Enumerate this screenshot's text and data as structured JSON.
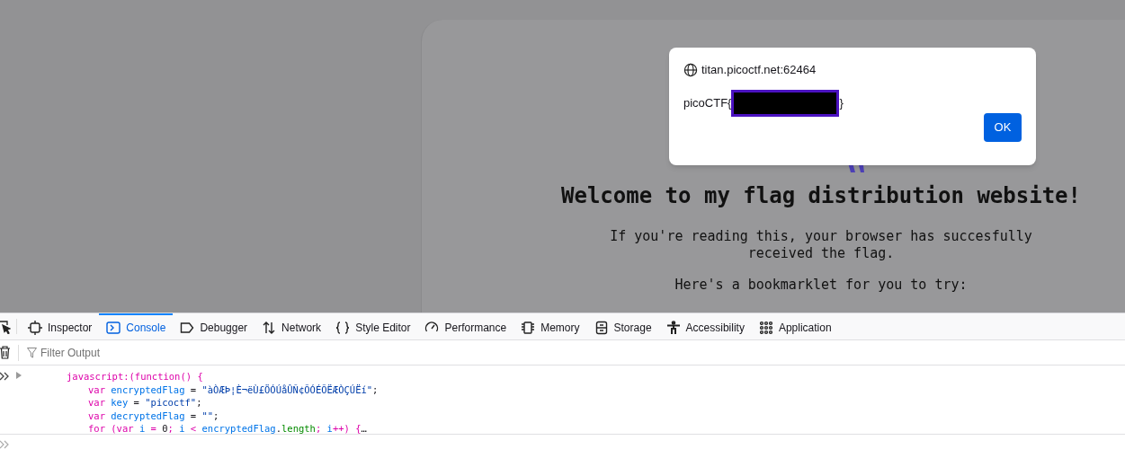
{
  "page": {
    "heading": "Welcome to my flag distribution website!",
    "paragraphs": [
      "If you're reading this, your browser has succesfully received the flag.",
      "Here's a bookmarklet for you to try:"
    ]
  },
  "alert": {
    "origin": "titan.picoctf.net:62464",
    "message_prefix": "picoCTF{",
    "redacted": true,
    "message_suffix": "}",
    "button": "OK"
  },
  "devtools": {
    "tabs": [
      {
        "label": "Inspector",
        "selected": false
      },
      {
        "label": "Console",
        "selected": true
      },
      {
        "label": "Debugger",
        "selected": false
      },
      {
        "label": "Network",
        "selected": false
      },
      {
        "label": "Style Editor",
        "selected": false
      },
      {
        "label": "Performance",
        "selected": false
      },
      {
        "label": "Memory",
        "selected": false
      },
      {
        "label": "Storage",
        "selected": false
      },
      {
        "label": "Accessibility",
        "selected": false
      },
      {
        "label": "Application",
        "selected": false
      }
    ],
    "filter_placeholder": "Filter Output",
    "console_lines": [
      [
        {
          "kind": "keyword",
          "text": "javascript:(function() {"
        }
      ],
      [
        {
          "kind": "keyword",
          "text": "var"
        },
        {
          "kind": "name",
          "text": " encryptedFlag"
        },
        {
          "kind": "plain",
          "text": " = "
        },
        {
          "kind": "string",
          "text": "\"àÒÆÞ¦È¬ëÙ£ÖÓÚåÛÑ¢ÕÓÉÕËÆÒÇÚËí\""
        },
        {
          "kind": "plain",
          "text": ";"
        }
      ],
      [
        {
          "kind": "keyword",
          "text": "var"
        },
        {
          "kind": "name",
          "text": " key"
        },
        {
          "kind": "plain",
          "text": " = "
        },
        {
          "kind": "string",
          "text": "\"picoctf\""
        },
        {
          "kind": "plain",
          "text": ";"
        }
      ],
      [
        {
          "kind": "keyword",
          "text": "var"
        },
        {
          "kind": "name",
          "text": " decryptedFlag"
        },
        {
          "kind": "plain",
          "text": " = "
        },
        {
          "kind": "string",
          "text": "\"\""
        },
        {
          "kind": "plain",
          "text": ";"
        }
      ],
      [
        {
          "kind": "keyword",
          "text": "for (var "
        },
        {
          "kind": "name",
          "text": "i"
        },
        {
          "kind": "keyword",
          "text": " = "
        },
        {
          "kind": "number",
          "text": "0"
        },
        {
          "kind": "keyword",
          "text": "; "
        },
        {
          "kind": "name",
          "text": "i"
        },
        {
          "kind": "keyword",
          "text": " < "
        },
        {
          "kind": "name",
          "text": "encryptedFlag"
        },
        {
          "kind": "plain",
          "text": "."
        },
        {
          "kind": "property",
          "text": "length"
        },
        {
          "kind": "keyword",
          "text": "; "
        },
        {
          "kind": "name",
          "text": "i"
        },
        {
          "kind": "keyword",
          "text": "++) {"
        },
        {
          "kind": "ellipsis",
          "text": "…"
        }
      ]
    ]
  }
}
